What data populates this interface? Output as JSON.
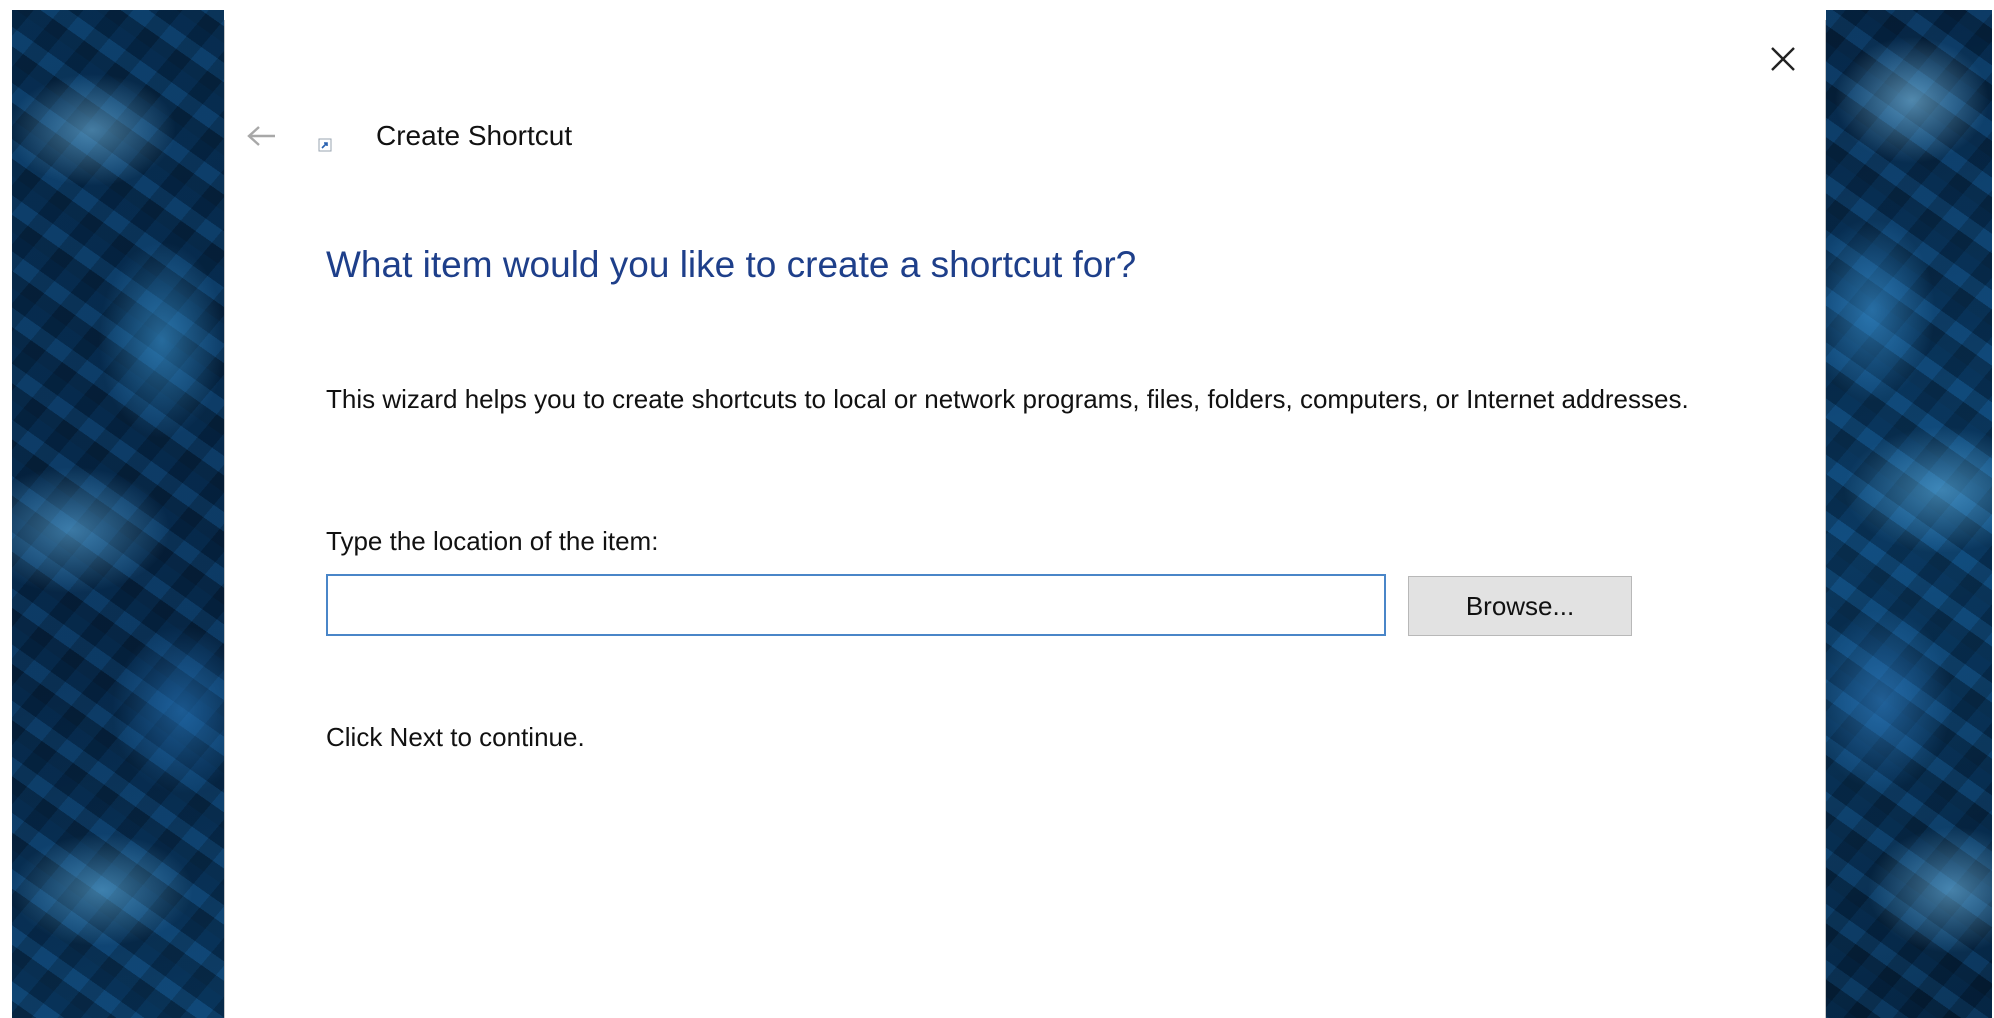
{
  "window": {
    "title": "Create Shortcut",
    "close_icon": "close-icon",
    "back_icon": "back-arrow-icon",
    "app_icon": "shortcut-icon"
  },
  "wizard": {
    "heading": "What item would you like to create a shortcut for?",
    "description": "This wizard helps you to create shortcuts to local or network programs, files, folders, computers, or Internet addresses.",
    "location_label": "Type the location of the item:",
    "location_value": "",
    "browse_label": "Browse...",
    "continue_text": "Click Next to continue."
  },
  "colors": {
    "heading": "#1e3f8a",
    "input_border": "#4a86c8",
    "button_bg": "#e2e2e2"
  }
}
